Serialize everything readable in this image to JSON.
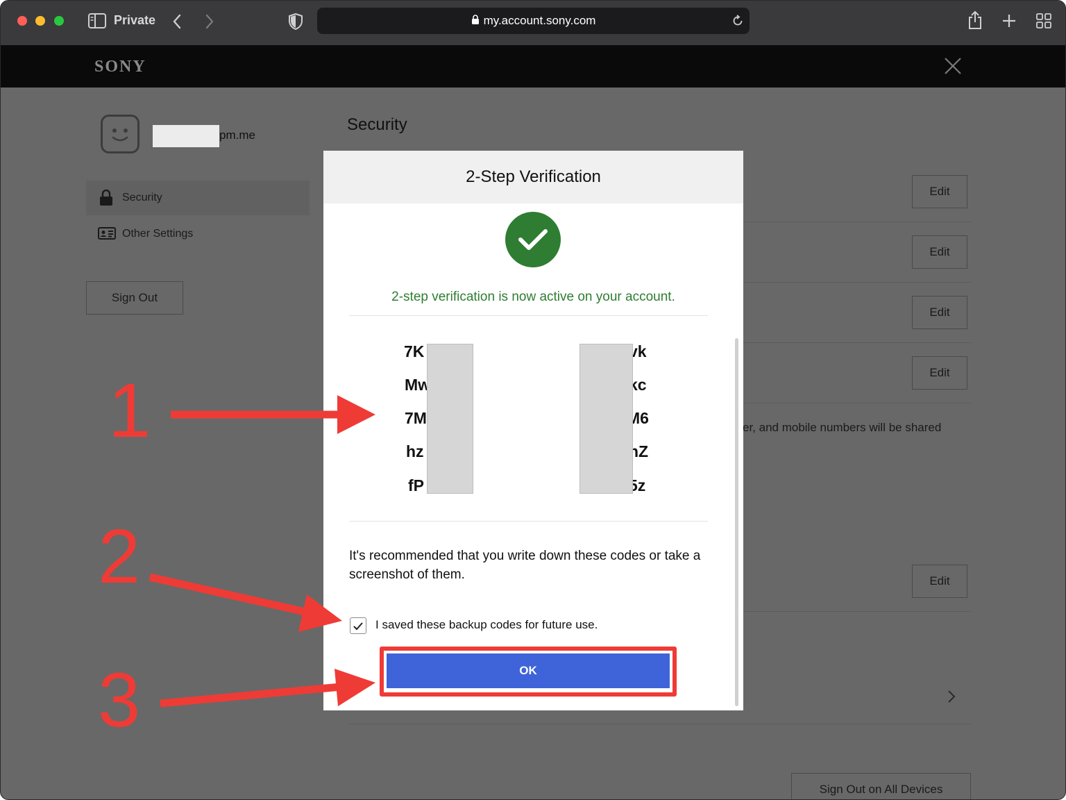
{
  "browser": {
    "private_label": "Private",
    "url": "my.account.sony.com"
  },
  "site": {
    "logo": "SONY"
  },
  "sidebar": {
    "email_suffix": "pm.me",
    "items": [
      {
        "label": "Security",
        "icon": "lock-icon",
        "selected": true
      },
      {
        "label": "Other Settings",
        "icon": "id-card-icon",
        "selected": false
      }
    ],
    "sign_out_label": "Sign Out"
  },
  "main": {
    "heading": "Security",
    "edit_label": "Edit",
    "shared_text": "er, and mobile numbers will be shared",
    "sign_out_all_label": "Sign Out on All Devices"
  },
  "modal": {
    "title": "2-Step Verification",
    "success_message": "2-step verification is now active on your account.",
    "codes_left": [
      "7K",
      "Mw",
      "7M",
      "hz",
      "fP"
    ],
    "codes_right": [
      "vk",
      "kc",
      "M6",
      "hZ",
      "5z"
    ],
    "recommendation": "It's recommended that you write down these codes or take a screenshot of them.",
    "checkbox_label": "I saved these backup codes for future use.",
    "checkbox_checked": true,
    "ok_label": "OK"
  },
  "annotations": {
    "step1": "1",
    "step2": "2",
    "step3": "3",
    "color": "#ef3b36"
  },
  "colors": {
    "success_green": "#2e7d32",
    "primary_blue": "#3f64d9"
  }
}
